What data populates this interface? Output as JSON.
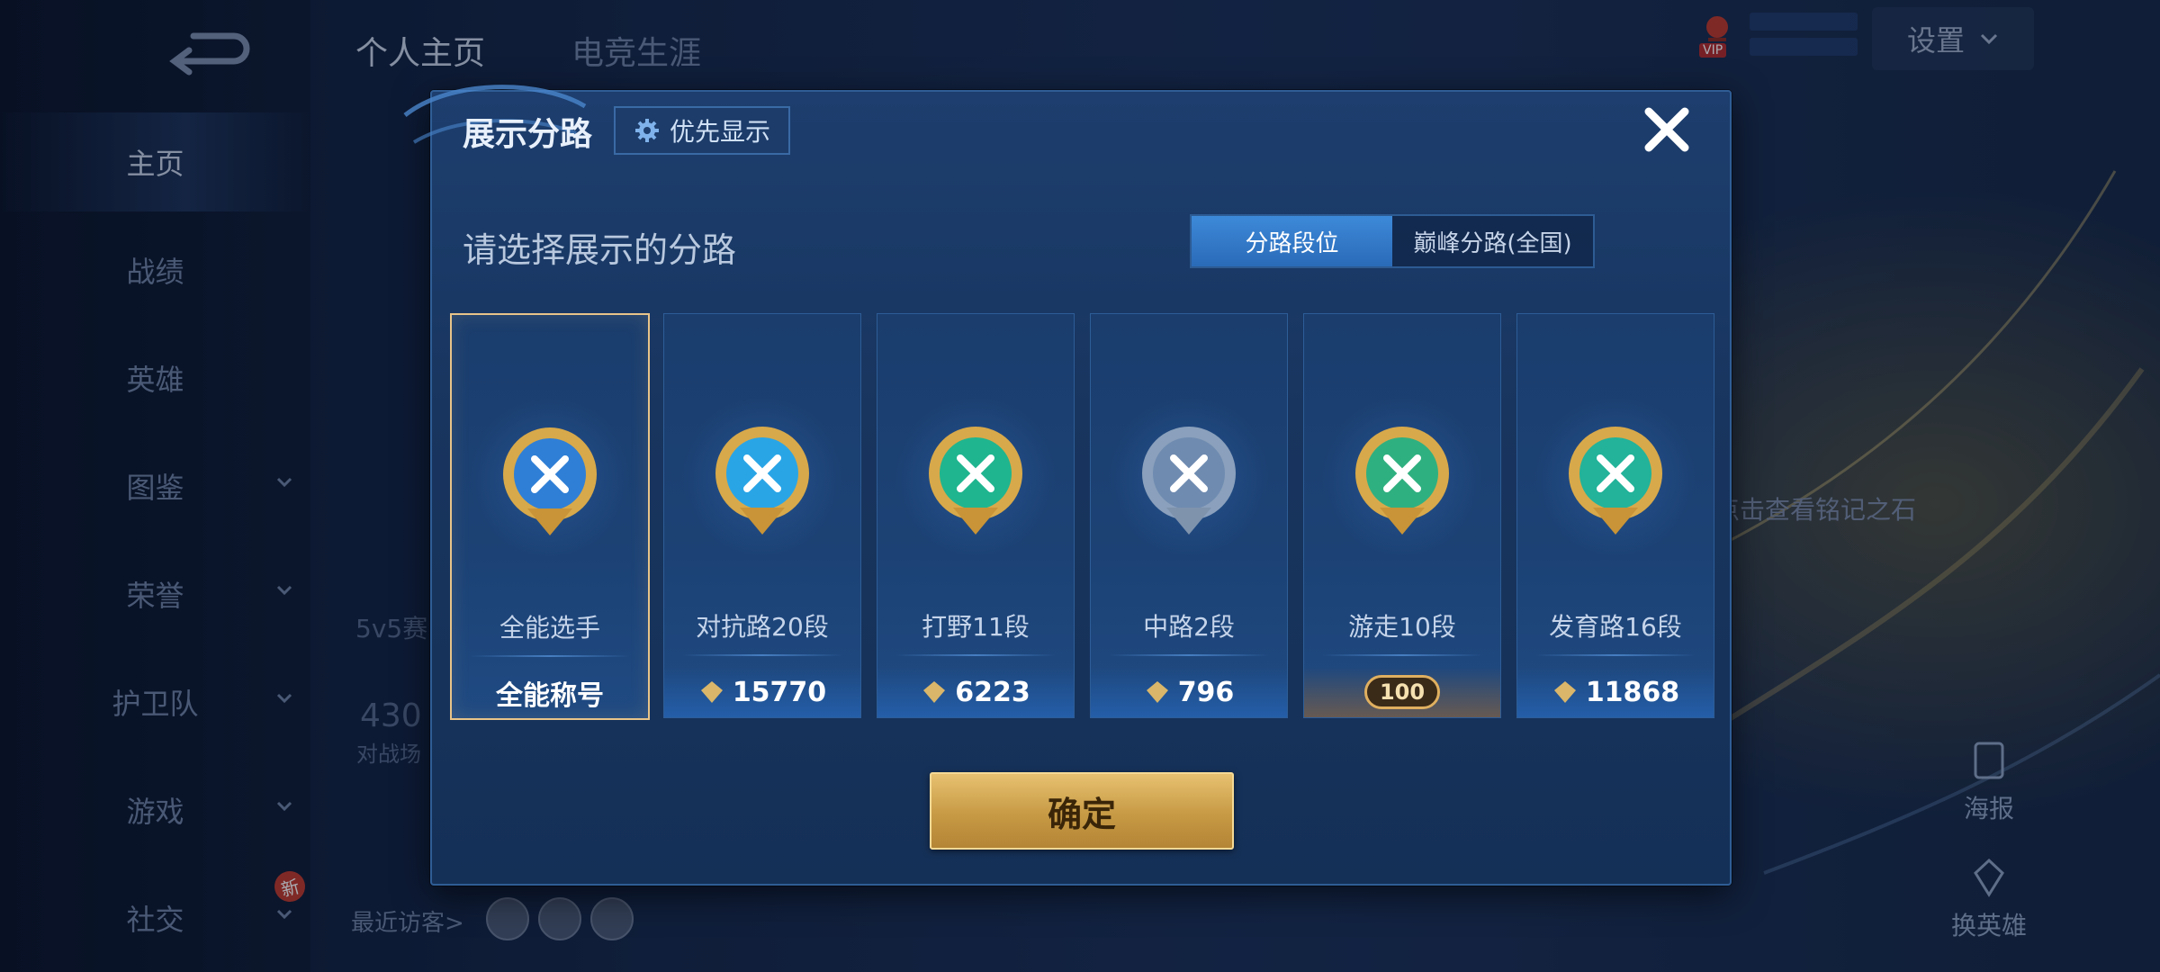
{
  "top_tabs": {
    "profile": "个人主页",
    "career": "电竞生涯"
  },
  "sidebar": {
    "items": [
      {
        "label": "主页",
        "active": true
      },
      {
        "label": "战绩"
      },
      {
        "label": "英雄"
      },
      {
        "label": "图鉴"
      },
      {
        "label": "荣誉"
      },
      {
        "label": "护卫队"
      },
      {
        "label": "游戏"
      },
      {
        "label": "社交"
      }
    ],
    "new_badge": "新"
  },
  "top_right": {
    "settings_label": "设置",
    "vip_label": "VIP"
  },
  "background": {
    "inscription_hint": "点击查看铭记之石",
    "poster_label": "海报",
    "switch_hero_label": "换英雄",
    "recent_visitors_label": "最近访客>",
    "mode_text": "5v5赛",
    "stat_value": "430",
    "stat_label": "对战场"
  },
  "modal": {
    "title": "展示分路",
    "priority_button": "优先显示",
    "subtitle": "请选择展示的分路",
    "toggle": {
      "active": "分路段位",
      "inactive": "巅峰分路(全国)"
    },
    "cards": [
      {
        "label": "全能选手",
        "score": "全能称号",
        "selected": true,
        "color": "#2f7fd6"
      },
      {
        "label": "对抗路20段",
        "score": "15770",
        "color": "#29a5e6"
      },
      {
        "label": "打野11段",
        "score": "6223",
        "color": "#1fb58f"
      },
      {
        "label": "中路2段",
        "score": "796",
        "color": "#6f8bb0"
      },
      {
        "label": "游走10段",
        "score": "100",
        "color": "#2fb080"
      },
      {
        "label": "发育路16段",
        "score": "11868",
        "color": "#22b39a"
      }
    ],
    "confirm_button": "确定"
  },
  "colors": {
    "accent_gold": "#e7c170",
    "panel_blue": "#1d3e6e",
    "selected_border": "#e9c489"
  },
  "icons": [
    "back-arrow-icon",
    "gear-icon",
    "close-icon",
    "chevron-down-icon",
    "score-diamond-icon",
    "emblem-icon"
  ]
}
